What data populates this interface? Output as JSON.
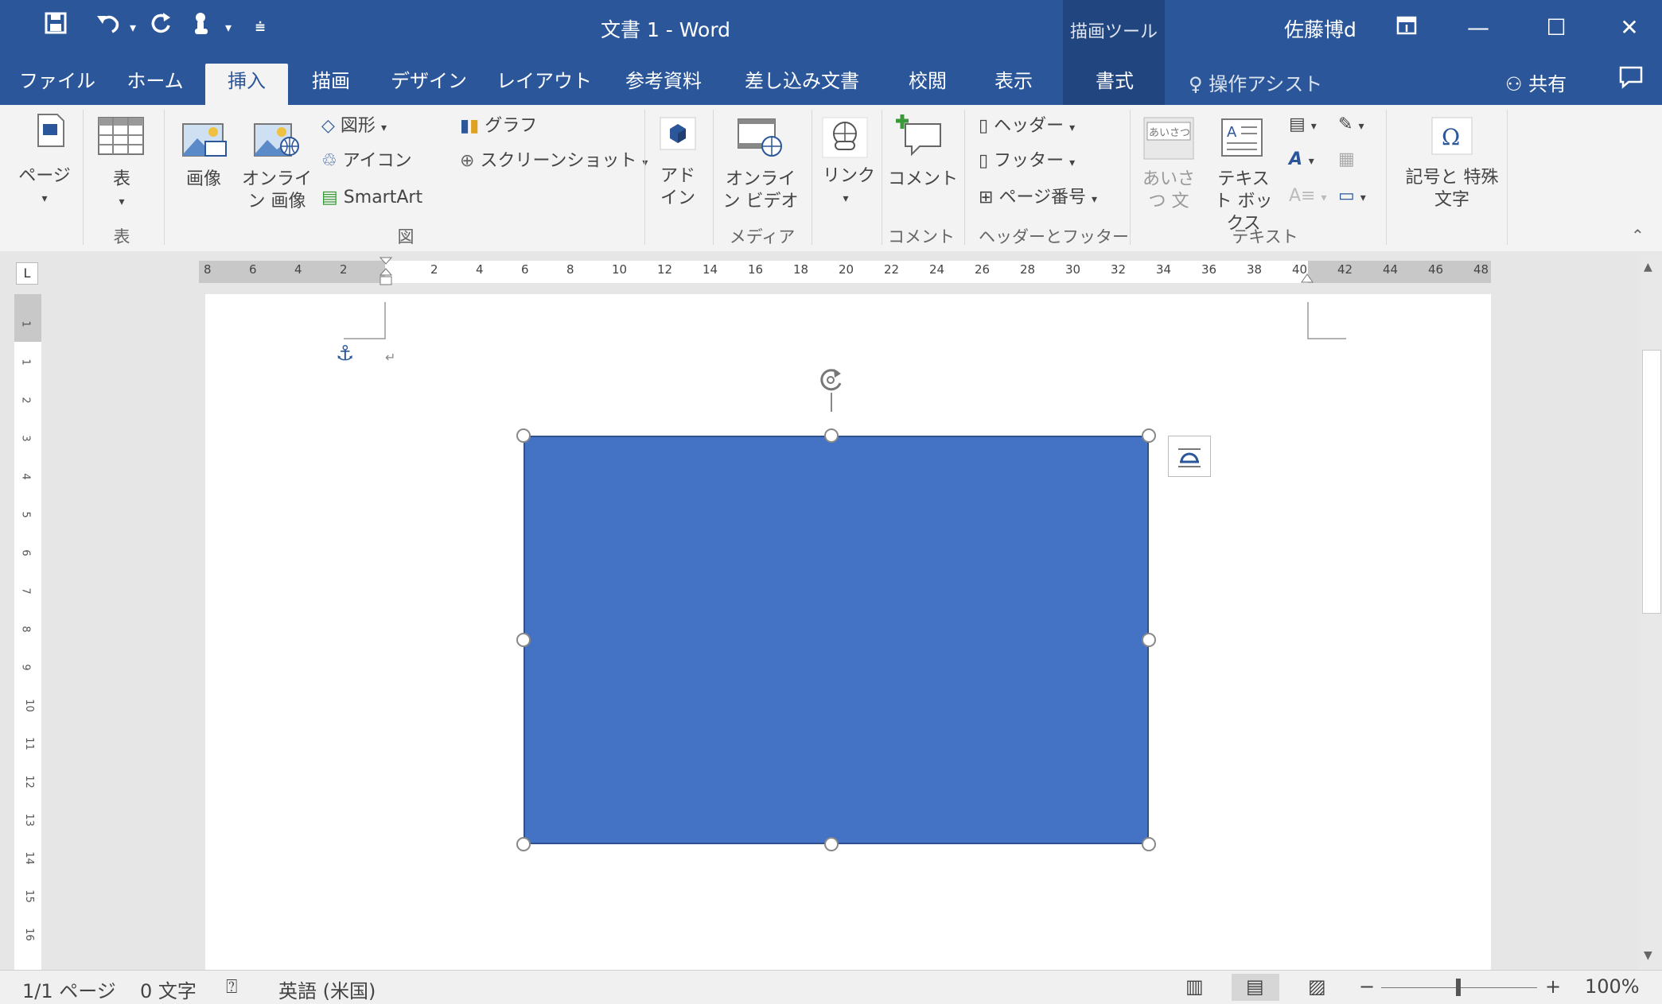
{
  "window": {
    "title": "文書 1  -  Word",
    "context_tool_label": "描画ツール",
    "user_name": "佐藤博d"
  },
  "quick_access": {
    "save_icon": "save-icon",
    "undo_icon": "undo-icon",
    "redo_icon": "redo-icon",
    "touch_icon": "touch-mode-icon"
  },
  "tabs": [
    {
      "label": "ファイル"
    },
    {
      "label": "ホーム"
    },
    {
      "label": "挿入"
    },
    {
      "label": "描画"
    },
    {
      "label": "デザイン"
    },
    {
      "label": "レイアウト"
    },
    {
      "label": "参考資料"
    },
    {
      "label": "差し込み文書"
    },
    {
      "label": "校閲"
    },
    {
      "label": "表示"
    },
    {
      "label": "書式"
    }
  ],
  "tell_me": "操作アシスト",
  "share_label": "共有",
  "ribbon": {
    "pages_label": "ページ",
    "table_label": "表",
    "table_group": "表",
    "picture_label": "画像",
    "online_picture_label": "オンライン 画像",
    "shapes_label": "図形",
    "icons_label": "アイコン",
    "smartart_label": "SmartArt",
    "chart_label": "グラフ",
    "screenshot_label": "スクリーンショット",
    "illustrations_group": "図",
    "addins_label": "アドイン",
    "online_video_label": "オンライン ビデオ",
    "media_group": "メディア",
    "link_label": "リンク",
    "comment_label": "コメント",
    "comments_group": "コメント",
    "header_label": "ヘッダー",
    "footer_label": "フッター",
    "page_number_label": "ページ番号",
    "header_footer_group": "ヘッダーとフッター",
    "greeting_label": "あいさつ 文",
    "greeting_icon_text": "あいさつ",
    "textbox_label": "テキスト ボックス",
    "text_group": "テキスト",
    "symbols_label": "記号と 特殊文字"
  },
  "ruler": {
    "ticks": [
      "8",
      "6",
      "4",
      "2",
      "2",
      "4",
      "6",
      "8",
      "10",
      "12",
      "14",
      "16",
      "18",
      "20",
      "22",
      "24",
      "26",
      "28",
      "30",
      "32",
      "34",
      "36",
      "38",
      "40",
      "42",
      "44",
      "46",
      "48"
    ],
    "vticks": [
      "1",
      "1",
      "2",
      "3",
      "4",
      "5",
      "6",
      "7",
      "8",
      "9",
      "10",
      "11",
      "12",
      "13",
      "14",
      "15",
      "16"
    ]
  },
  "status": {
    "page": "1/1 ページ",
    "words": "0 文字",
    "language": "英語 (米国)",
    "zoom": "100%"
  },
  "colors": {
    "accent": "#2b579a",
    "shape_fill": "#4472c4"
  }
}
